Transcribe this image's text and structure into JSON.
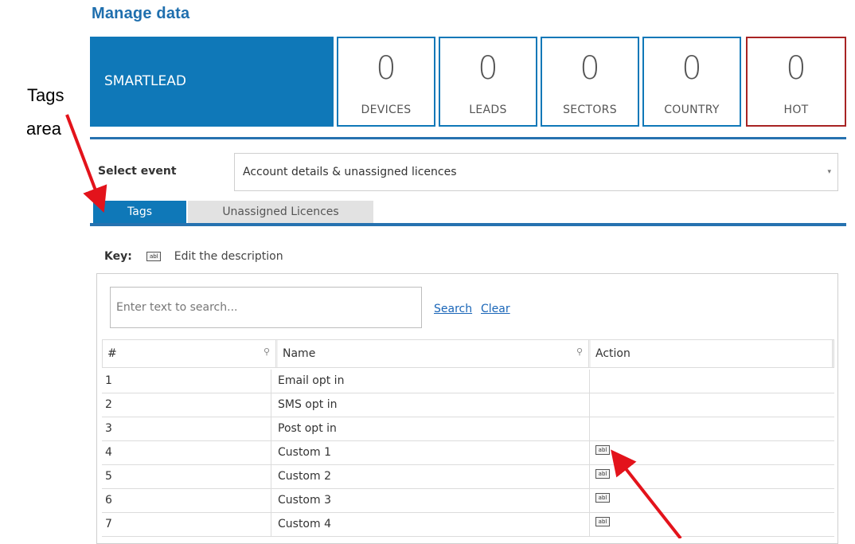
{
  "page": {
    "title": "Manage data"
  },
  "banner": {
    "brand": "SMARTLEAD",
    "stats": [
      {
        "value": "0",
        "label": "DEVICES"
      },
      {
        "value": "0",
        "label": "LEADS"
      },
      {
        "value": "0",
        "label": "SECTORS"
      },
      {
        "value": "0",
        "label": "COUNTRY"
      },
      {
        "value": "0",
        "label": "HOT"
      }
    ]
  },
  "annotation": {
    "line1": "Tags",
    "line2": "area",
    "arrow_color": "#e3131b"
  },
  "event": {
    "label": "Select event",
    "selected": "Account details & unassigned licences",
    "caret": "▾"
  },
  "tabs": [
    {
      "label": "Tags"
    },
    {
      "label": "Unassigned Licences"
    }
  ],
  "key": {
    "label": "Key:",
    "icon_text": "abl",
    "description": "Edit the description"
  },
  "grid": {
    "search_placeholder": "Enter text to search...",
    "search_link": "Search",
    "clear_link": "Clear",
    "filter_icon": "⚲",
    "columns": [
      "#",
      "Name",
      "Action"
    ],
    "rows": [
      {
        "num": "1",
        "name": "Email opt in",
        "action": ""
      },
      {
        "num": "2",
        "name": "SMS opt in",
        "action": ""
      },
      {
        "num": "3",
        "name": "Post opt in",
        "action": ""
      },
      {
        "num": "4",
        "name": "Custom 1",
        "action": "abl"
      },
      {
        "num": "5",
        "name": "Custom 2",
        "action": "abl"
      },
      {
        "num": "6",
        "name": "Custom 3",
        "action": "abl"
      },
      {
        "num": "7",
        "name": "Custom 4",
        "action": "abl"
      }
    ]
  },
  "colors": {
    "brand_blue": "#0f78b8",
    "hot_border": "#a82323",
    "link": "#1a66b8"
  }
}
